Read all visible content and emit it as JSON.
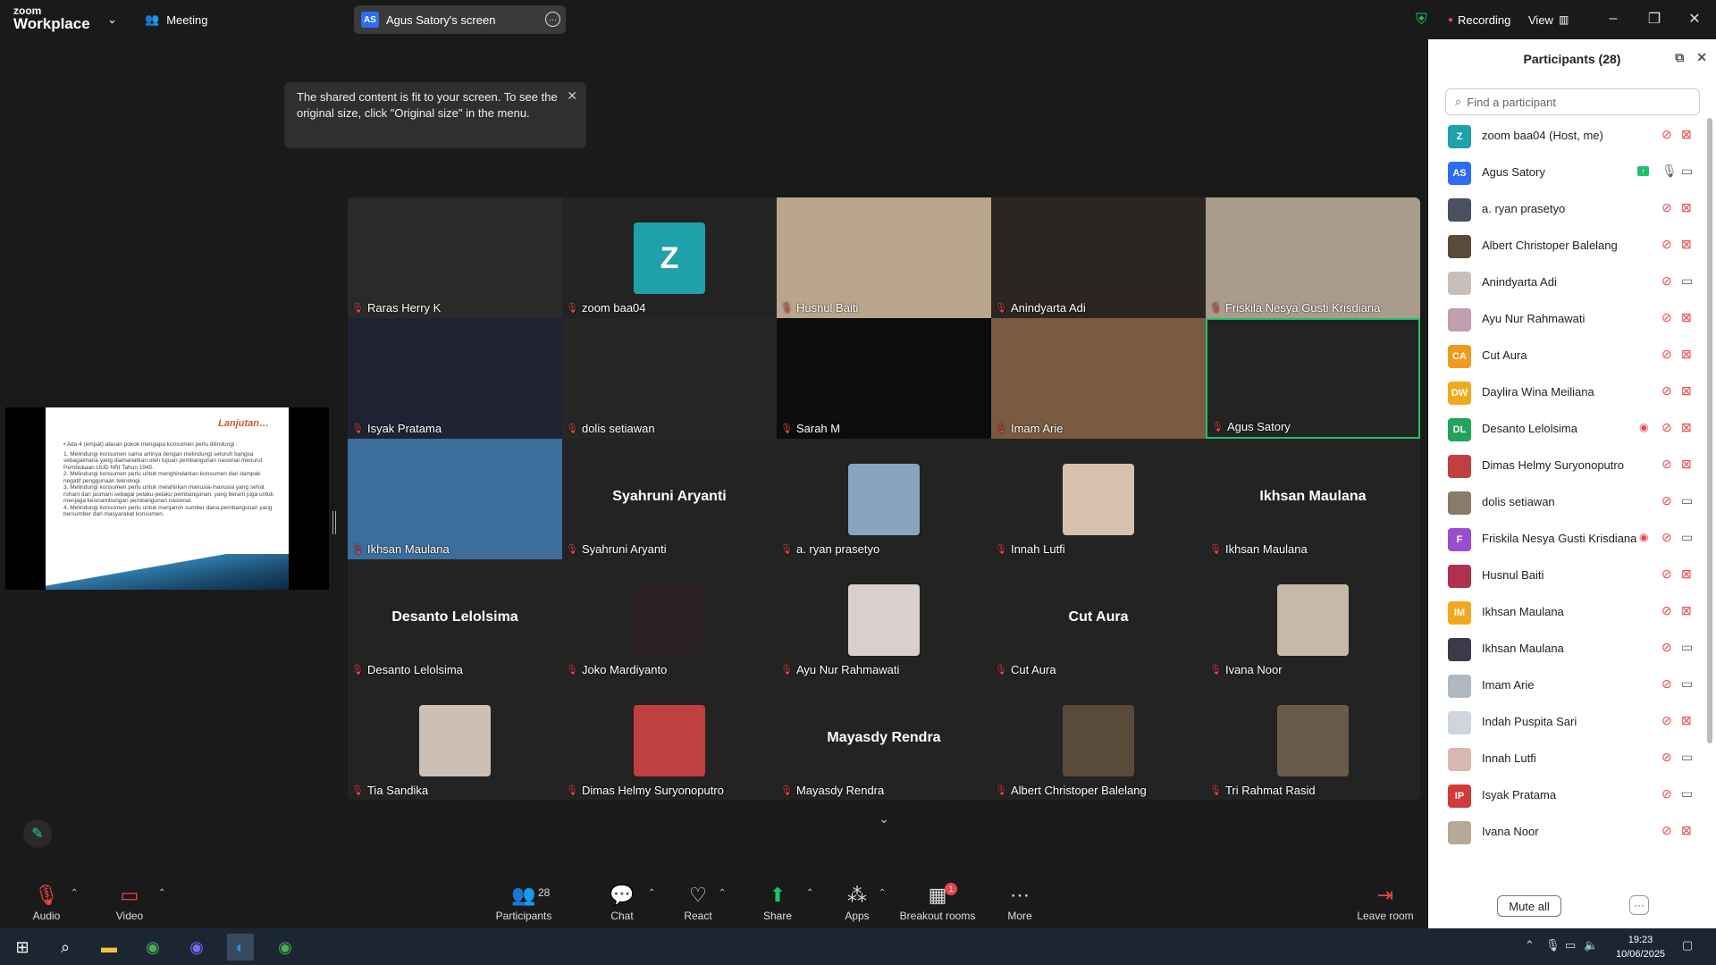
{
  "app": {
    "logo_line1": "zoom",
    "logo_line2": "Workplace",
    "meeting_label": "Meeting",
    "share_badge": "AS",
    "share_title": "Agus Satory's screen",
    "recording_label": "Recording",
    "view_label": "View"
  },
  "tooltip": {
    "text": "The shared content is fit to your screen. To see the original size, click \"Original size\" in the menu."
  },
  "slide": {
    "title": "Lanjutan…",
    "lines": [
      "• Ada 4 (empat) alasan pokok mengapa konsumen perlu dilindungi :",
      "1. Melindungi konsumen sama artinya dengan melindungi seluruh bangsa sebagaimana yang diamanatkan oleh tujuan pembangunan nasional menurut Pembukaan UUD NRI Tahun 1945.",
      "2. Melindungi konsumen perlu untuk menghindarkan konsumen dari dampak negatif penggunaan teknologi.",
      "3. Melindungi konsumen perlu untuk melahirkan manusia-manusia yang sehat rohani dan jasmani sebagai pelaku-pelaku pembangunan, yang berarti juga untuk menjaga kesinambungan pembangunan nasional.",
      "4. Melindungi konsumen perlu untuk menjamin sumber dana pembangunan yang bersumber dari masyarakat konsumen."
    ]
  },
  "grid": {
    "tiles": [
      {
        "name": "Raras Herry K",
        "bg": "#2a2a2a"
      },
      {
        "name": "zoom baa04",
        "initial": "Z"
      },
      {
        "name": "Husnul Baiti",
        "bg": "#b9a58c"
      },
      {
        "name": "Anindyarta Adi",
        "bg": "#2b2622"
      },
      {
        "name": "Friskila Nesya Gusti Krisdiana",
        "bg": "#a99c8c"
      },
      {
        "name": "Isyak Pratama",
        "bg": "#1e2232"
      },
      {
        "name": "dolis setiawan",
        "bg": "#262626"
      },
      {
        "name": "Sarah M",
        "bg": "#0d0d0d"
      },
      {
        "name": "Imam Arie",
        "bg": "#7a5a40"
      },
      {
        "name": "Agus Satory",
        "bg": "#232323"
      },
      {
        "name": "Ikhsan Maulana",
        "bg": "#3d6d9a"
      },
      {
        "name": "Syahruni Aryanti",
        "big": "Syahruni Aryanti"
      },
      {
        "name": "a. ryan prasetyo",
        "avatar": "#8aa4c0"
      },
      {
        "name": "Innah Lutfi",
        "avatar": "#d8c0b0"
      },
      {
        "name": "Ikhsan Maulana",
        "big": "Ikhsan Maulana"
      },
      {
        "name": "Desanto Lelolsima",
        "big": "Desanto Lelolsima"
      },
      {
        "name": "Joko Mardiyanto",
        "avatar": "#2a2222"
      },
      {
        "name": "Ayu Nur Rahmawati",
        "avatar": "#d8d0cc"
      },
      {
        "name": "Cut Aura",
        "big": "Cut Aura"
      },
      {
        "name": "Ivana Noor",
        "avatar": "#c8b8a8"
      },
      {
        "name": "Tia Sandika",
        "avatar": "#cbbfb6"
      },
      {
        "name": "Dimas Helmy Suryonoputro",
        "avatar": "#c04040"
      },
      {
        "name": "Mayasdy Rendra",
        "big": "Mayasdy Rendra"
      },
      {
        "name": "Albert Christoper Balelang",
        "avatar": "#5a4a3a"
      },
      {
        "name": "Tri Rahmat Rasid",
        "avatar": "#6a5a4a"
      }
    ]
  },
  "panel": {
    "title": "Participants (28)",
    "search_placeholder": "Find a participant",
    "mute_all": "Mute all",
    "more": "···",
    "participants": [
      {
        "name": "zoom baa04 (Host, me)",
        "initials": "Z",
        "color": "#1fa0aa",
        "mic": "muted",
        "cam": "off"
      },
      {
        "name": "Agus Satory",
        "initials": "AS",
        "color": "#2d6df6",
        "mic": "on",
        "cam": "on",
        "sharing": true
      },
      {
        "name": "a. ryan prasetyo",
        "initials": "",
        "color": "#4a5060",
        "mic": "muted",
        "cam": "off"
      },
      {
        "name": "Albert Christoper Balelang",
        "initials": "",
        "color": "#5a4a3a",
        "mic": "muted",
        "cam": "off"
      },
      {
        "name": "Anindyarta Adi",
        "initials": "",
        "color": "#c8c0b8",
        "mic": "muted",
        "cam": "on"
      },
      {
        "name": "Ayu Nur Rahmawati",
        "initials": "",
        "color": "#c0a0b0",
        "mic": "muted",
        "cam": "off"
      },
      {
        "name": "Cut Aura",
        "initials": "CA",
        "color": "#f29a1d",
        "mic": "muted",
        "cam": "off"
      },
      {
        "name": "Daylira Wina Meiliana",
        "initials": "DW",
        "color": "#f2a81d",
        "mic": "muted",
        "cam": "off"
      },
      {
        "name": "Desanto Lelolsima",
        "initials": "DL",
        "color": "#23a35a",
        "mic": "muted",
        "cam": "off",
        "rec": true
      },
      {
        "name": "Dimas Helmy Suryonoputro",
        "initials": "",
        "color": "#c04040",
        "mic": "muted",
        "cam": "off"
      },
      {
        "name": "dolis setiawan",
        "initials": "",
        "color": "#8a7a6a",
        "mic": "muted",
        "cam": "on"
      },
      {
        "name": "Friskila Nesya Gusti Krisdiana",
        "initials": "F",
        "color": "#9b4dd1",
        "mic": "muted",
        "cam": "on",
        "rec": true
      },
      {
        "name": "Husnul Baiti",
        "initials": "",
        "color": "#b03050",
        "mic": "muted",
        "cam": "off"
      },
      {
        "name": "Ikhsan Maulana",
        "initials": "IM",
        "color": "#f2a81d",
        "mic": "muted",
        "cam": "off"
      },
      {
        "name": "Ikhsan Maulana",
        "initials": "",
        "color": "#3a3a48",
        "mic": "muted",
        "cam": "on"
      },
      {
        "name": "Imam Arie",
        "initials": "",
        "color": "#b0b8c0",
        "mic": "muted",
        "cam": "on"
      },
      {
        "name": "Indah Puspita Sari",
        "initials": "",
        "color": "#d0d4dc",
        "mic": "muted",
        "cam": "off"
      },
      {
        "name": "Innah Lutfi",
        "initials": "",
        "color": "#d8b8b0",
        "mic": "muted",
        "cam": "on"
      },
      {
        "name": "Isyak Pratama",
        "initials": "IP",
        "color": "#d33a3a",
        "mic": "muted",
        "cam": "on"
      },
      {
        "name": "Ivana Noor",
        "initials": "",
        "color": "#b8a898",
        "mic": "muted",
        "cam": "off"
      },
      {
        "name": "Joko Mardiyanto",
        "initials": "",
        "color": "#2a2222",
        "mic": "muted",
        "cam": "off"
      }
    ]
  },
  "toolbar": {
    "audio": "Audio",
    "video": "Video",
    "participants": "Participants",
    "participants_count": "28",
    "chat": "Chat",
    "react": "React",
    "share": "Share",
    "apps": "Apps",
    "breakout": "Breakout rooms",
    "breakout_badge": "1",
    "more": "More",
    "leave": "Leave room"
  },
  "taskbar": {
    "time": "19:23",
    "date": "10/06/2025"
  },
  "colors": {
    "accent": "#2d6df6",
    "muted_red": "#e8464a",
    "active_green": "#21c06a"
  }
}
